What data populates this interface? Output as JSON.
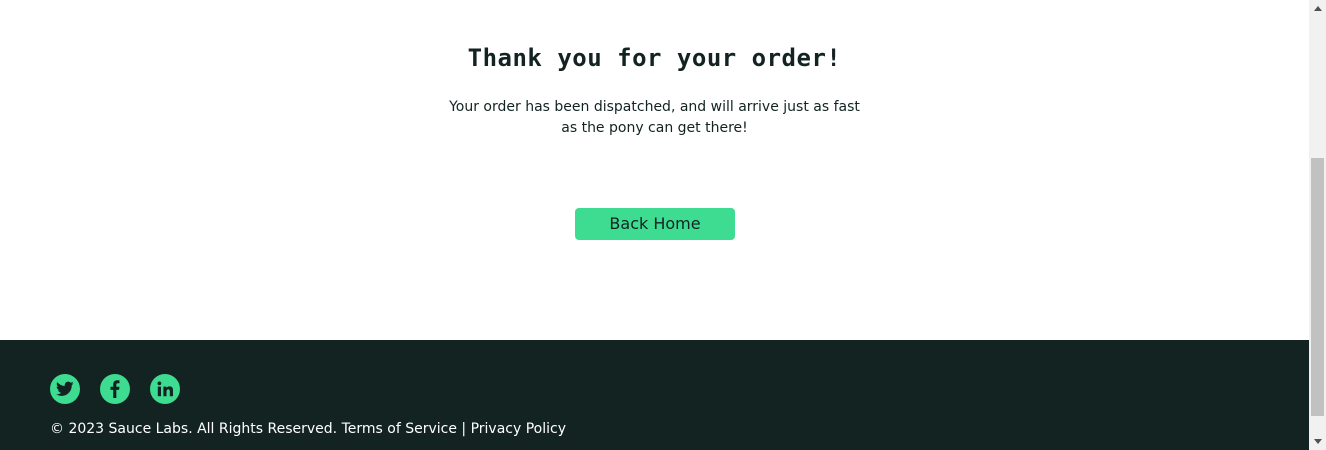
{
  "main": {
    "title": "Thank you for your order!",
    "message": "Your order has been dispatched, and will arrive just as fast as the pony can get there!",
    "back_home_label": "Back Home"
  },
  "footer": {
    "social": [
      {
        "name": "Twitter",
        "icon": "twitter-icon"
      },
      {
        "name": "Facebook",
        "icon": "facebook-icon"
      },
      {
        "name": "LinkedIn",
        "icon": "linkedin-icon"
      }
    ],
    "copyright": "© 2023 Sauce Labs. All Rights Reserved. ",
    "terms_label": "Terms of Service",
    "separator": " | ",
    "privacy_label": "Privacy Policy"
  },
  "colors": {
    "accent": "#3ddc91",
    "footer_bg": "#132322",
    "text": "#132322"
  }
}
